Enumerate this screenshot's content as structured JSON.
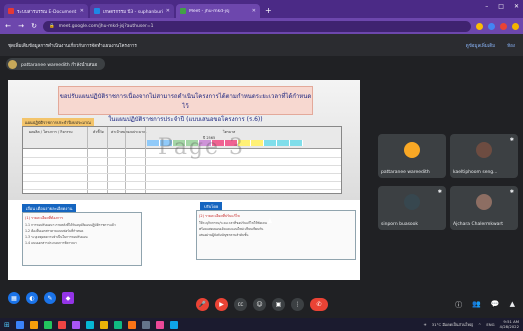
{
  "browser": {
    "tabs": [
      {
        "title": "ระบบสารบรรณ E-Document Syst...",
        "color": "#e53935"
      },
      {
        "title": "เกษตรกรรม ปี3 - suphanburi.thai...",
        "color": "#1e88e5"
      },
      {
        "title": "Meet - jhu-mkd-jsj",
        "color": "#43a047"
      }
    ],
    "new_tab": "+",
    "window_controls": [
      "–",
      "□",
      "✕"
    ],
    "url": "meet.google.com/jhu-mkd-jsj?authuser=1",
    "nav": {
      "back": "←",
      "forward": "→",
      "reload": "↻"
    }
  },
  "meet": {
    "header_title": "ชุดเพิ่มเติมข้อมูลการดำเนินงานเกี่ยวกับการจัดทำแผนงานโครงการ",
    "header_links": [
      "ดูข้อมูลเพิ่มเติม",
      "ห้อง"
    ],
    "presenter_label": "pattaranee wareedith กำลังนำเสนอ"
  },
  "slide": {
    "banner_line1": "ขอปรับแผนปฏิบัติราชการเนื่องจากไม่สามารถดำเนินโครงการได้ตามกำหนดระยะเวลาที่ได้กำหนดไว้",
    "banner_line2": "ในแผนปฏิบัติราชการประจำปี (แบบเสนอขอโครงการ (ร.6))",
    "table_title": "แผนปฏิบัติราชการประจำปีงบประมาณ",
    "table_headers": [
      "ผลผลิต / โครงการ / กิจกรรม",
      "ตัวชี้วัด",
      "ค่าเป้าหมาย",
      "งบประมาณ",
      "ไตรมาส"
    ],
    "quarter_label": "ปี 2565",
    "watermark": "Page 3",
    "left_heading": "เลื่อน เดือนรายละเอียดงาน",
    "left_box_head": "(1) รายละเอียดที่ต้องการ",
    "left_box_lines": [
      "1.1 การขอปรับแผนฯ ภายหลังที่ได้รับอนุมัติแผนปฏิบัติราชการแล้ว",
      "1.2 ต้องยื่นเอกสารตามแบบฟอร์มที่กำหนด",
      "1.3 ระบุเหตุผลความจำเป็นในการขอปรับแผน",
      "1.4 แนบเอกสารประกอบการพิจารณา"
    ],
    "right_heading": "ปรับโดย",
    "right_box_head": "(2) รายละเอียดที่ปรับแก้ไข",
    "right_box_lines": [
      "ให้ระบุกิจกรรม/ระยะเวลาที่ขอปรับแก้ไขให้ชัดเจน",
      "พร้อมแสดงแผนเดิมและแผนใหม่เปรียบเทียบกัน",
      "เสนอผ่านผู้บังคับบัญชาตามลำดับชั้น"
    ]
  },
  "participants": [
    {
      "name": "pattaranee wareedith",
      "avatar_color": "#f9a825"
    },
    {
      "name": "kaeltiphoom seng...",
      "avatar_color": "#6d4c41"
    },
    {
      "name": "sinporn buasook",
      "avatar_color": "#37474f"
    },
    {
      "name": "Ajchara Chalermkwart",
      "avatar_color": "#8d6e63"
    }
  ],
  "slide_tools": [
    {
      "icon": "▦",
      "color": "#1a73e8"
    },
    {
      "icon": "◐",
      "color": "#1a73e8"
    },
    {
      "icon": "✎",
      "color": "#1a73e8"
    },
    {
      "icon": "◆",
      "color": "#9334e6"
    }
  ],
  "controls": [
    {
      "icon": "🎤",
      "color": "#ea4335"
    },
    {
      "icon": "▶",
      "color": "#ea4335"
    },
    {
      "icon": "CC",
      "color": "#3c4043"
    },
    {
      "icon": "☺",
      "color": "#3c4043"
    },
    {
      "icon": "▣",
      "color": "#3c4043"
    },
    {
      "icon": "⋮",
      "color": "#3c4043"
    },
    {
      "icon": "✆",
      "color": "#ea4335"
    }
  ],
  "right_controls": [
    "ⓘ",
    "👥",
    "💬",
    "▲"
  ],
  "taskbar": {
    "icons": [
      "#3b82f6",
      "#f59e0b",
      "#22c55e",
      "#ef4444",
      "#a855f7",
      "#06b6d4",
      "#eab308",
      "#10b981",
      "#f97316",
      "#64748b",
      "#ec4899",
      "#0ea5e9"
    ],
    "weather": "31°C มีแดดเป็นส่วนใหญ่",
    "tray_label": "ENG",
    "time": "9:51 AM",
    "date": "4/28/2022"
  }
}
